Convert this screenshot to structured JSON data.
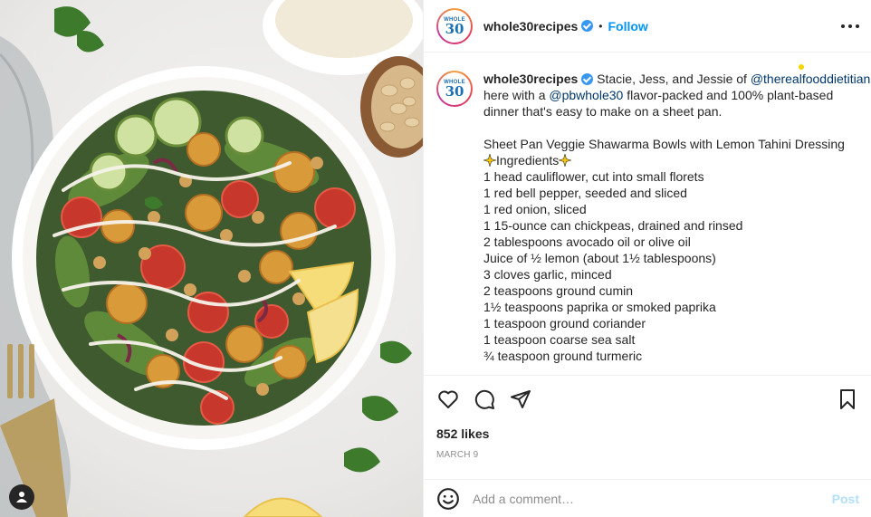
{
  "photo": {
    "alt_icon": "food-photo",
    "user_tag_icon": "person-icon"
  },
  "header": {
    "logo_top": "WHOLE",
    "logo_num": "30",
    "username": "whole30recipes",
    "separator": "•",
    "follow_label": "Follow",
    "more_icon": "more-horizontal-icon"
  },
  "caption": {
    "username": "whole30recipes",
    "intro_1": " Stacie, Jess, and Jessie of ",
    "mention_1": "@therealfooddietitians",
    "intro_2a": "here with a ",
    "mention_2": "@pbwhole30",
    "intro_2b": " flavor-packed and 100% plant-based",
    "intro_3": "dinner that's easy to make on a sheet pan.",
    "title": "Sheet Pan Veggie Shawarma Bowls with Lemon Tahini Dressing",
    "ingredients_heading": "Ingredients",
    "ingredients": [
      "1 head cauliflower, cut into small florets",
      "1 red bell pepper, seeded and sliced",
      "1 red onion, sliced",
      "1 15-ounce can chickpeas, drained and rinsed",
      "2 tablespoons avocado oil or olive oil",
      "Juice of ½ lemon (about 1½ tablespoons)",
      "3 cloves garlic, minced",
      "2 teaspoons ground cumin",
      "1½ teaspoons paprika or smoked paprika",
      "1 teaspoon ground coriander",
      "1 teaspoon coarse sea salt",
      "¾ teaspoon ground turmeric"
    ]
  },
  "actions": {
    "like_icon": "heart-icon",
    "comment_icon": "comment-icon",
    "share_icon": "share-icon",
    "save_icon": "bookmark-icon",
    "likes": "852 likes",
    "date": "MARCH 9"
  },
  "add_comment": {
    "emoji_icon": "emoji-icon",
    "placeholder": "Add a comment…",
    "post_label": "Post"
  },
  "colors": {
    "accent": "#0095f6",
    "mention": "#00376b",
    "post_disabled": "#b2dffc",
    "verified": "#3897f0"
  }
}
